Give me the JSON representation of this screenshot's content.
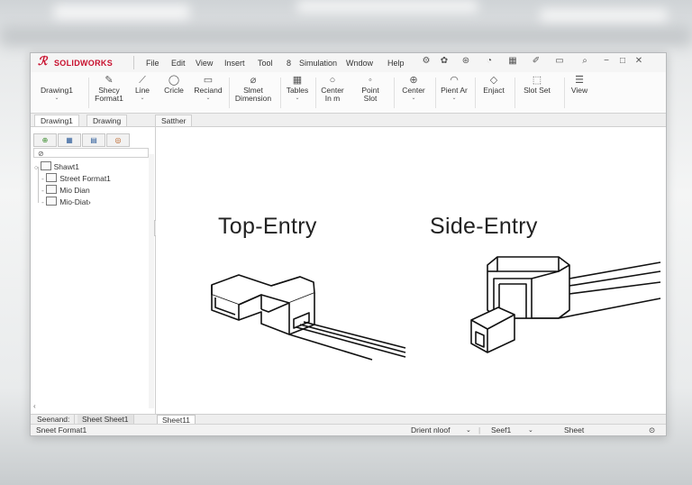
{
  "app": {
    "name": "SOLIDWORKS"
  },
  "menu": [
    "File",
    "Edit",
    "View",
    "Insert",
    "Tool",
    "8",
    "Simulation",
    "Wndow",
    "Help"
  ],
  "ribbon": [
    {
      "label": "Drawing1",
      "icon": "drawing-icon",
      "glyph": "",
      "arrow": "⌄"
    },
    {
      "label": "Shecy\nFormat1",
      "icon": "sketch-icon",
      "glyph": "✎",
      "arrow": ""
    },
    {
      "label": "Line",
      "icon": "line-icon",
      "glyph": "⟋",
      "arrow": "⌄"
    },
    {
      "label": "Cricle",
      "icon": "circle-icon",
      "glyph": "◯",
      "arrow": ""
    },
    {
      "label": "Reciand",
      "icon": "rectangle-icon",
      "glyph": "▭",
      "arrow": "⌄"
    },
    {
      "label": "Slmet\nDimension",
      "icon": "dimension-icon",
      "glyph": "⌀",
      "arrow": ""
    },
    {
      "label": "Tables",
      "icon": "table-icon",
      "glyph": "▦",
      "arrow": "⌄"
    },
    {
      "label": "Center\nIn​m",
      "icon": "center-icon",
      "glyph": "○",
      "arrow": ""
    },
    {
      "label": "Point\nSlot",
      "icon": "point-icon",
      "glyph": "◦",
      "arrow": ""
    },
    {
      "label": "Center",
      "icon": "center-mark-icon",
      "glyph": "⊕",
      "arrow": "⌄"
    },
    {
      "label": "Pient Ar",
      "icon": "arc-icon",
      "glyph": "◠",
      "arrow": "⌄"
    },
    {
      "label": "Enjact",
      "icon": "extract-icon",
      "glyph": "◇",
      "arrow": ""
    },
    {
      "label": "Slot Set",
      "icon": "slot-icon",
      "glyph": "⬚",
      "arrow": ""
    },
    {
      "label": "View",
      "icon": "view-icon",
      "glyph": "☰",
      "arrow": ""
    }
  ],
  "command_tabs": [
    "Drawing1",
    "Drawing",
    "Satther"
  ],
  "feature_manager": {
    "tabs": [
      "⊕",
      "▦",
      "▤",
      "◎"
    ],
    "tree": [
      "Shawt1",
      "Street Format1",
      "Mio Dian",
      "Mio-Diat›"
    ]
  },
  "drawing": {
    "left_label": "Top-Entry",
    "right_label": "Side-Entry"
  },
  "bottom_tabs": [
    "Seenand:",
    "Sheet Sheet1",
    "Sheet11"
  ],
  "status": {
    "left": "Sneet Format1",
    "middle1": "Drient nloof",
    "middle2": "Seef1",
    "right": "Sheet"
  }
}
